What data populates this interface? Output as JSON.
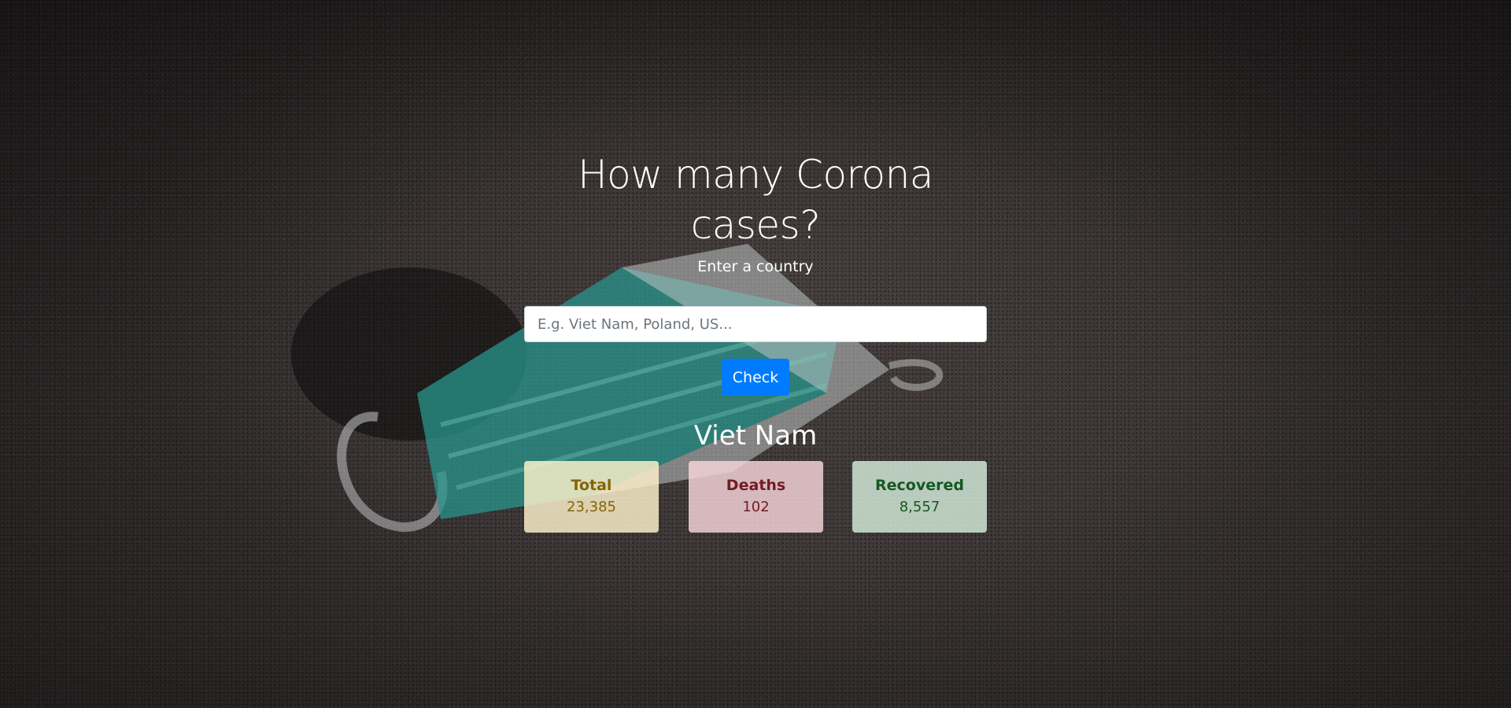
{
  "hero": {
    "title": "How many Corona cases?",
    "subtitle": "Enter a country"
  },
  "search": {
    "placeholder": "E.g. Viet Nam, Poland, US...",
    "value": ""
  },
  "check_button": {
    "label": "Check"
  },
  "result": {
    "country": "Viet Nam",
    "cards": {
      "total": {
        "label": "Total",
        "value": "23,385"
      },
      "deaths": {
        "label": "Deaths",
        "value": "102"
      },
      "recovered": {
        "label": "Recovered",
        "value": "8,557"
      }
    }
  },
  "colors": {
    "primary_button": "#007bff",
    "total_card": "#fff3cd",
    "deaths_card": "#f8d7da",
    "recovered_card": "#d4edda"
  }
}
